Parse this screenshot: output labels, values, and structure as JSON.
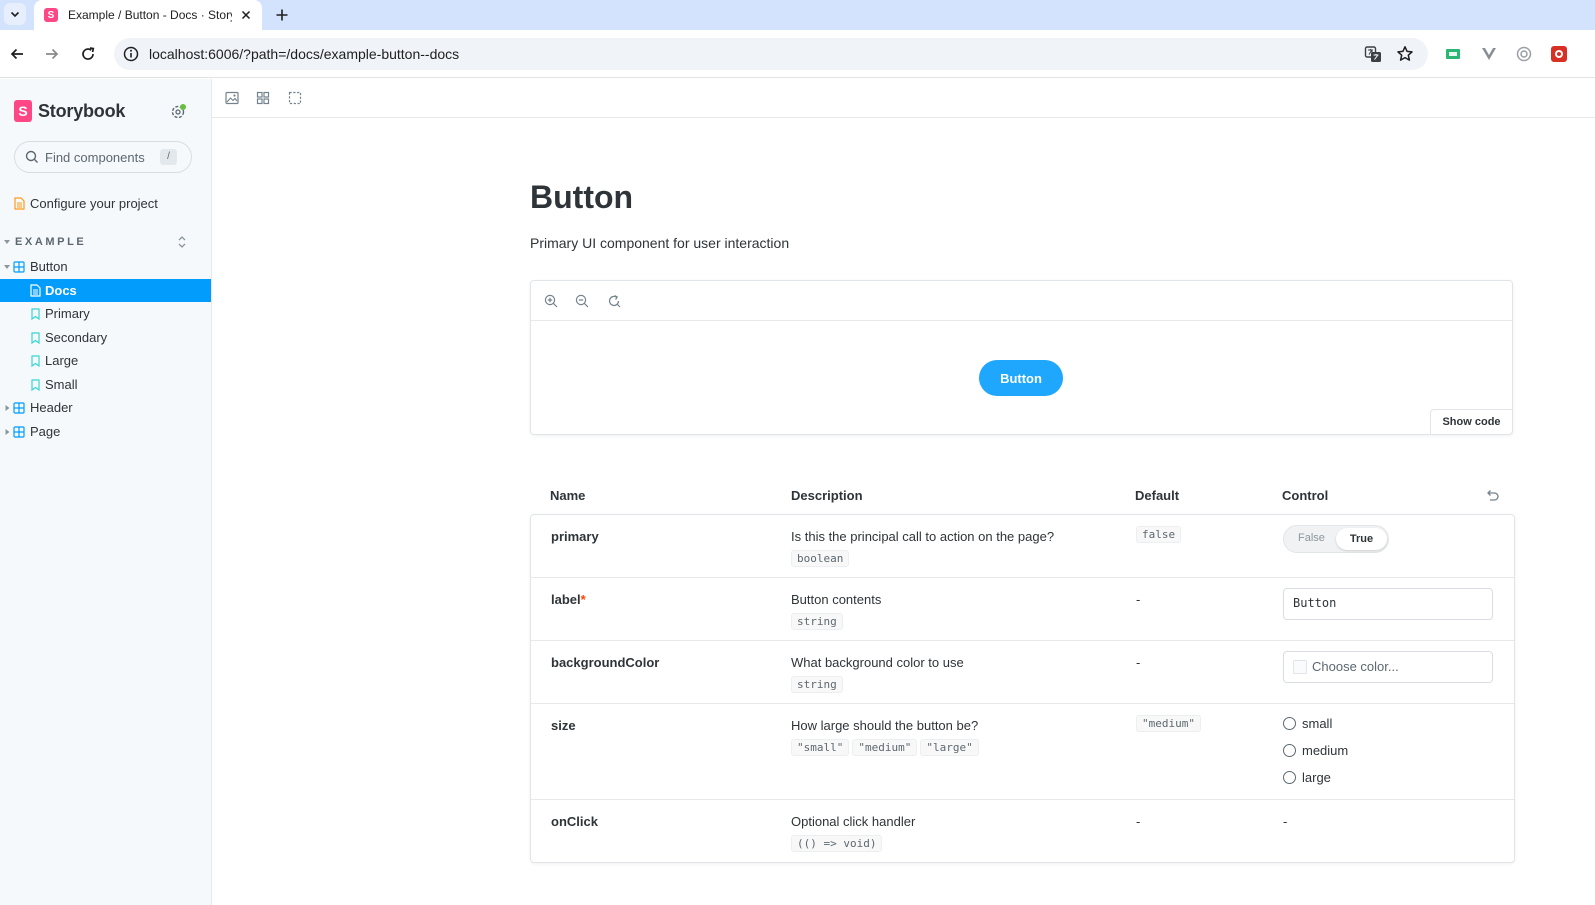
{
  "browser": {
    "tab_title": "Example / Button - Docs · Storybook",
    "favicon_letter": "S",
    "url": "localhost:6006/?path=/docs/example-button--docs"
  },
  "sidebar": {
    "brand_letter": "S",
    "brand": "Storybook",
    "search_placeholder": "Find components",
    "search_shortcut": "/",
    "configure": "Configure your project",
    "group": "EXAMPLE",
    "items": [
      {
        "label": "Button"
      },
      {
        "label": "Docs"
      },
      {
        "label": "Primary"
      },
      {
        "label": "Secondary"
      },
      {
        "label": "Large"
      },
      {
        "label": "Small"
      },
      {
        "label": "Header"
      },
      {
        "label": "Page"
      }
    ]
  },
  "doc": {
    "title": "Button",
    "subtitle": "Primary UI component for user interaction",
    "demo_button": "Button",
    "show_code": "Show code"
  },
  "args": {
    "headers": [
      "Name",
      "Description",
      "Default",
      "Control"
    ],
    "rows": [
      {
        "name": "primary",
        "desc": "Is this the principal call to action on the page?",
        "type": "boolean",
        "default": "false",
        "toggle_false": "False",
        "toggle_true": "True"
      },
      {
        "name": "label",
        "required": "*",
        "desc": "Button contents",
        "type": "string",
        "default": "-",
        "value": "Button"
      },
      {
        "name": "backgroundColor",
        "desc": "What background color to use",
        "type": "string",
        "default": "-",
        "placeholder": "Choose color..."
      },
      {
        "name": "size",
        "desc": "How large should the button be?",
        "types": [
          "\"small\"",
          "\"medium\"",
          "\"large\""
        ],
        "default": "\"medium\"",
        "options": [
          "small",
          "medium",
          "large"
        ]
      },
      {
        "name": "onClick",
        "desc": "Optional click handler",
        "type": "(() => void)",
        "default": "-",
        "control": "-"
      }
    ]
  },
  "colors": {
    "accent": "#029cfd",
    "demo_button": "#1ea7fd",
    "brand": "#ff4785",
    "tabstrip": "#d3e3fd"
  }
}
